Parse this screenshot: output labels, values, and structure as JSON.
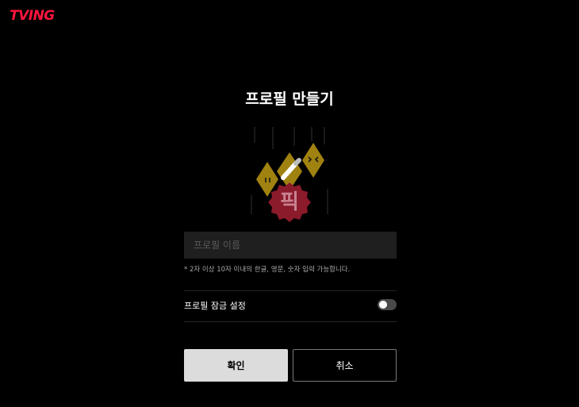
{
  "brand": {
    "logo_text": "TVING",
    "accent": "#ff153c"
  },
  "page": {
    "title": "프로필 만들기"
  },
  "avatar": {
    "badge_text": "픽",
    "diamond_color": "#a08210",
    "badge_color": "#8b1a2b"
  },
  "form": {
    "name_placeholder": "프로필 이름",
    "name_value": "",
    "hint": "* 2자 이상 10자 이내의 한글, 영문, 숫자 입력 가능합니다.",
    "lock_label": "프로필 잠금 설정",
    "lock_enabled": false
  },
  "actions": {
    "confirm_label": "확인",
    "cancel_label": "취소"
  }
}
